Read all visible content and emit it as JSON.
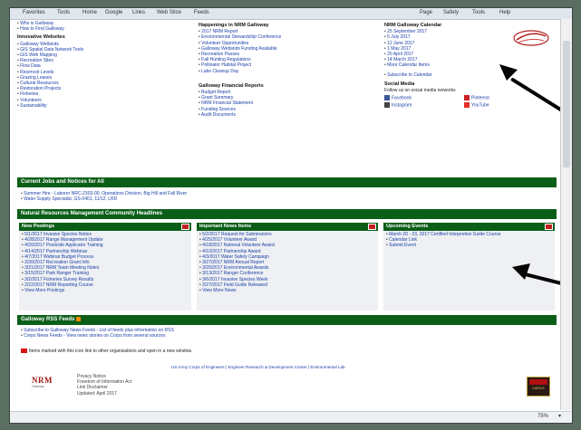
{
  "toolbar": {
    "items": [
      "Favorites",
      "Tools",
      "Home",
      "Google",
      "Links",
      "Web Slice",
      "Feeds"
    ],
    "right_items": [
      "Page",
      "Safety",
      "Tools",
      "Help"
    ]
  },
  "top_left": {
    "items": [
      "Who is Galloway",
      "How to Find Galloway"
    ],
    "heading": "Innovative Websites",
    "links": [
      "Galloway Wetlands",
      "GIS Spatial Data Network Tools",
      "GIS Web Mapping",
      "Recreation Sites",
      "Flow Data",
      "Reservoir Levels",
      "Grazing Leases",
      "Cultural Resources",
      "Restoration Projects",
      "Fisheries",
      "Volunteers",
      "Sustainability"
    ]
  },
  "top_mid": {
    "heading": "Happenings in NRM Galloway",
    "items": [
      "2017 NRM Report",
      "Environmental Stewardship Conference",
      "Volunteer Opportunities",
      "Galloway Wetlands Funding Available",
      "Recreation Passes",
      "Fall Hunting Regulations",
      "Pollinator Habitat Project",
      "Lake Cleanup Day"
    ],
    "heading2": "Galloway Financial Reports",
    "items2": [
      "Budget Report",
      "Grant Summary",
      "NRM Financial Statement",
      "Funding Sources",
      "Audit Documents"
    ]
  },
  "top_right": {
    "heading": "NRM Galloway Calendar",
    "dates": [
      "25 September 2017",
      "5 July 2017",
      "12 June 2017",
      "1 May 2017",
      "20 April 2017",
      "14 March 2017",
      "More Calendar Items"
    ],
    "extra": "Subscribe to Calendar",
    "social_heading": "Social Media",
    "social_sub": "Follow us on social media networks",
    "social": [
      "Facebook",
      "Pinterest",
      "Instagram",
      "YouTube"
    ]
  },
  "jobs": {
    "title": "Current Jobs and Notices for All",
    "items": [
      "Summer Hire - Laborer NRC-2303-00, Operations Division, Big Hill and Fall River",
      "Water Supply Specialist, GS-0401, 11/12, LRD"
    ]
  },
  "nrm_bar": "Natural Resources Management Community Headlines",
  "panels": [
    {
      "title": "New Postings",
      "items": [
        "5/1/2017 Invasive Species Notice",
        "4/28/2017 Range Management Update",
        "4/20/2017 Pesticide Applicator Training",
        "4/14/2017 Partnership Webinar",
        "4/7/2017 Webinar Budget Process",
        "3/30/2017 Recreation Grant Info",
        "3/21/2017 NRM Team Meeting Notes",
        "3/15/2017 Park Ranger Training",
        "3/2/2017 Fisheries Survey Results",
        "2/22/2017 NRM Reporting Course",
        "View More Postings"
      ]
    },
    {
      "title": "Important News Items",
      "items": [
        "5/2/2017 Request for Submissions",
        "4/25/2017 Volunteer Award",
        "4/18/2017 National Volunteer Award",
        "4/10/2017 Partnership Award",
        "4/3/2017 Water Safety Campaign",
        "3/27/2017 NRM Annual Report",
        "3/20/2017 Environmental Awards",
        "3/13/2017 Ranger Conference",
        "3/6/2017 Invasive Species Week",
        "2/27/2017 Field Guide Released",
        "View More News"
      ]
    },
    {
      "title": "Upcoming Events",
      "items": [
        "March 20 - 23, 2017 Certified Interpretive Guide Course",
        "Calendar Link",
        "Submit Event"
      ]
    }
  ],
  "rss": {
    "title": "Galloway RSS Feeds",
    "items": [
      "Subscribe to Galloway News Feeds - List of feeds plus information on RSS",
      "Corps News Feeds - View news stories on Corps from several sources"
    ]
  },
  "notice": "Items marked with this icon link to other organizations and open in a new window.",
  "footer": {
    "links": [
      "US Army Corps of Engineers",
      "Engineer Research & Development Center",
      "Environmental Lab"
    ],
    "left_lines": [
      "Privacy Notice",
      "Freedom of Information Act",
      "Link Disclaimer",
      "Updated: April 2017"
    ],
    "nrm_logo": "NRM",
    "nrm_sub": "Gateway",
    "badge": "CASTLE"
  },
  "status": {
    "zoom": "75%"
  },
  "colors": {
    "green_bar": "#0b5e18",
    "link": "#1a3fa8",
    "red_icon": "#d11111"
  }
}
